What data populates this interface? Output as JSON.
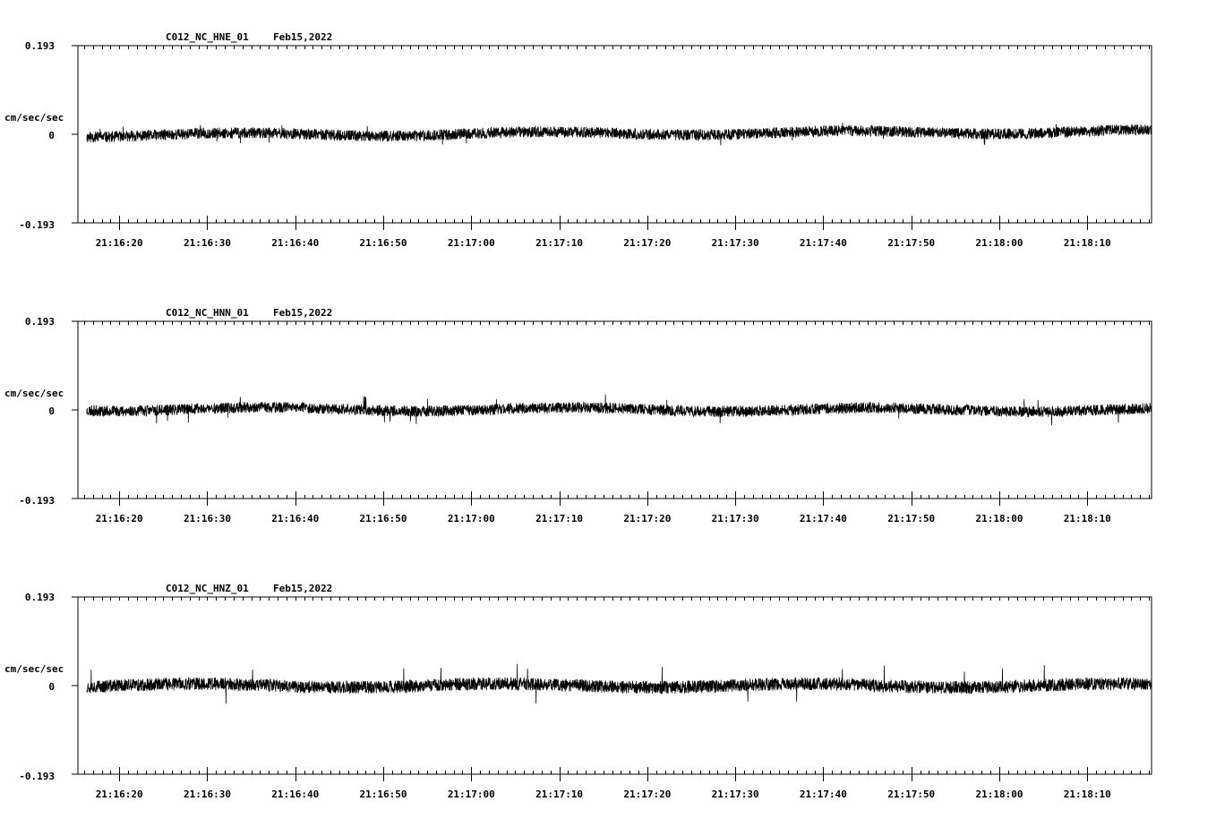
{
  "colors": {
    "background": "#ffffff",
    "trace": "#000000",
    "axis": "#000000"
  },
  "chart_data": [
    {
      "type": "line",
      "title": "C012_NC_HNE_01",
      "date": "Feb15,2022",
      "ylabel": "cm/sec/sec",
      "ylim": [
        -0.193,
        0.193
      ],
      "ytick_labels": [
        "0.193",
        "0",
        "-0.193"
      ],
      "xlim_seconds": [
        76575.3,
        76697.3
      ],
      "trace_start_seconds": 76576.3,
      "xtick_labels": [
        "21:16:20",
        "21:16:30",
        "21:16:40",
        "21:16:50",
        "21:17:00",
        "21:17:10",
        "21:17:20",
        "21:17:30",
        "21:17:40",
        "21:17:50",
        "21:18:00",
        "21:18:10"
      ],
      "series": [
        {
          "values_desc": "",
          "noise_amplitude": 0.012,
          "peak_amplitude": 0.024,
          "offset_trend": [
            -0.002,
            0.006
          ],
          "seed": 11
        }
      ]
    },
    {
      "type": "line",
      "title": "C012_NC_HNN_01",
      "date": "Feb15,2022",
      "ylabel": "cm/sec/sec",
      "ylim": [
        -0.193,
        0.193
      ],
      "ytick_labels": [
        "0.193",
        "0",
        "-0.193"
      ],
      "xlim_seconds": [
        76575.3,
        76697.3
      ],
      "trace_start_seconds": 76576.3,
      "xtick_labels": [
        "21:16:20",
        "21:16:30",
        "21:16:40",
        "21:16:50",
        "21:17:00",
        "21:17:10",
        "21:17:20",
        "21:17:30",
        "21:17:40",
        "21:17:50",
        "21:18:00",
        "21:18:10"
      ],
      "series": [
        {
          "values_desc": "",
          "noise_amplitude": 0.012,
          "peak_amplitude": 0.03,
          "offset_trend": [
            0.002,
            0.0
          ],
          "seed": 23
        }
      ]
    },
    {
      "type": "line",
      "title": "C012_NC_HNZ_01",
      "date": "Feb15,2022",
      "ylabel": "cm/sec/sec",
      "ylim": [
        -0.193,
        0.193
      ],
      "ytick_labels": [
        "0.193",
        "0",
        "-0.193"
      ],
      "xlim_seconds": [
        76575.3,
        76697.3
      ],
      "trace_start_seconds": 76576.3,
      "xtick_labels": [
        "21:16:20",
        "21:16:30",
        "21:16:40",
        "21:16:50",
        "21:17:00",
        "21:17:10",
        "21:17:20",
        "21:17:30",
        "21:17:40",
        "21:17:50",
        "21:18:00",
        "21:18:10"
      ],
      "series": [
        {
          "values_desc": "",
          "noise_amplitude": 0.014,
          "peak_amplitude": 0.045,
          "offset_trend": [
            0.0,
            0.0
          ],
          "seed": 37
        }
      ]
    }
  ]
}
